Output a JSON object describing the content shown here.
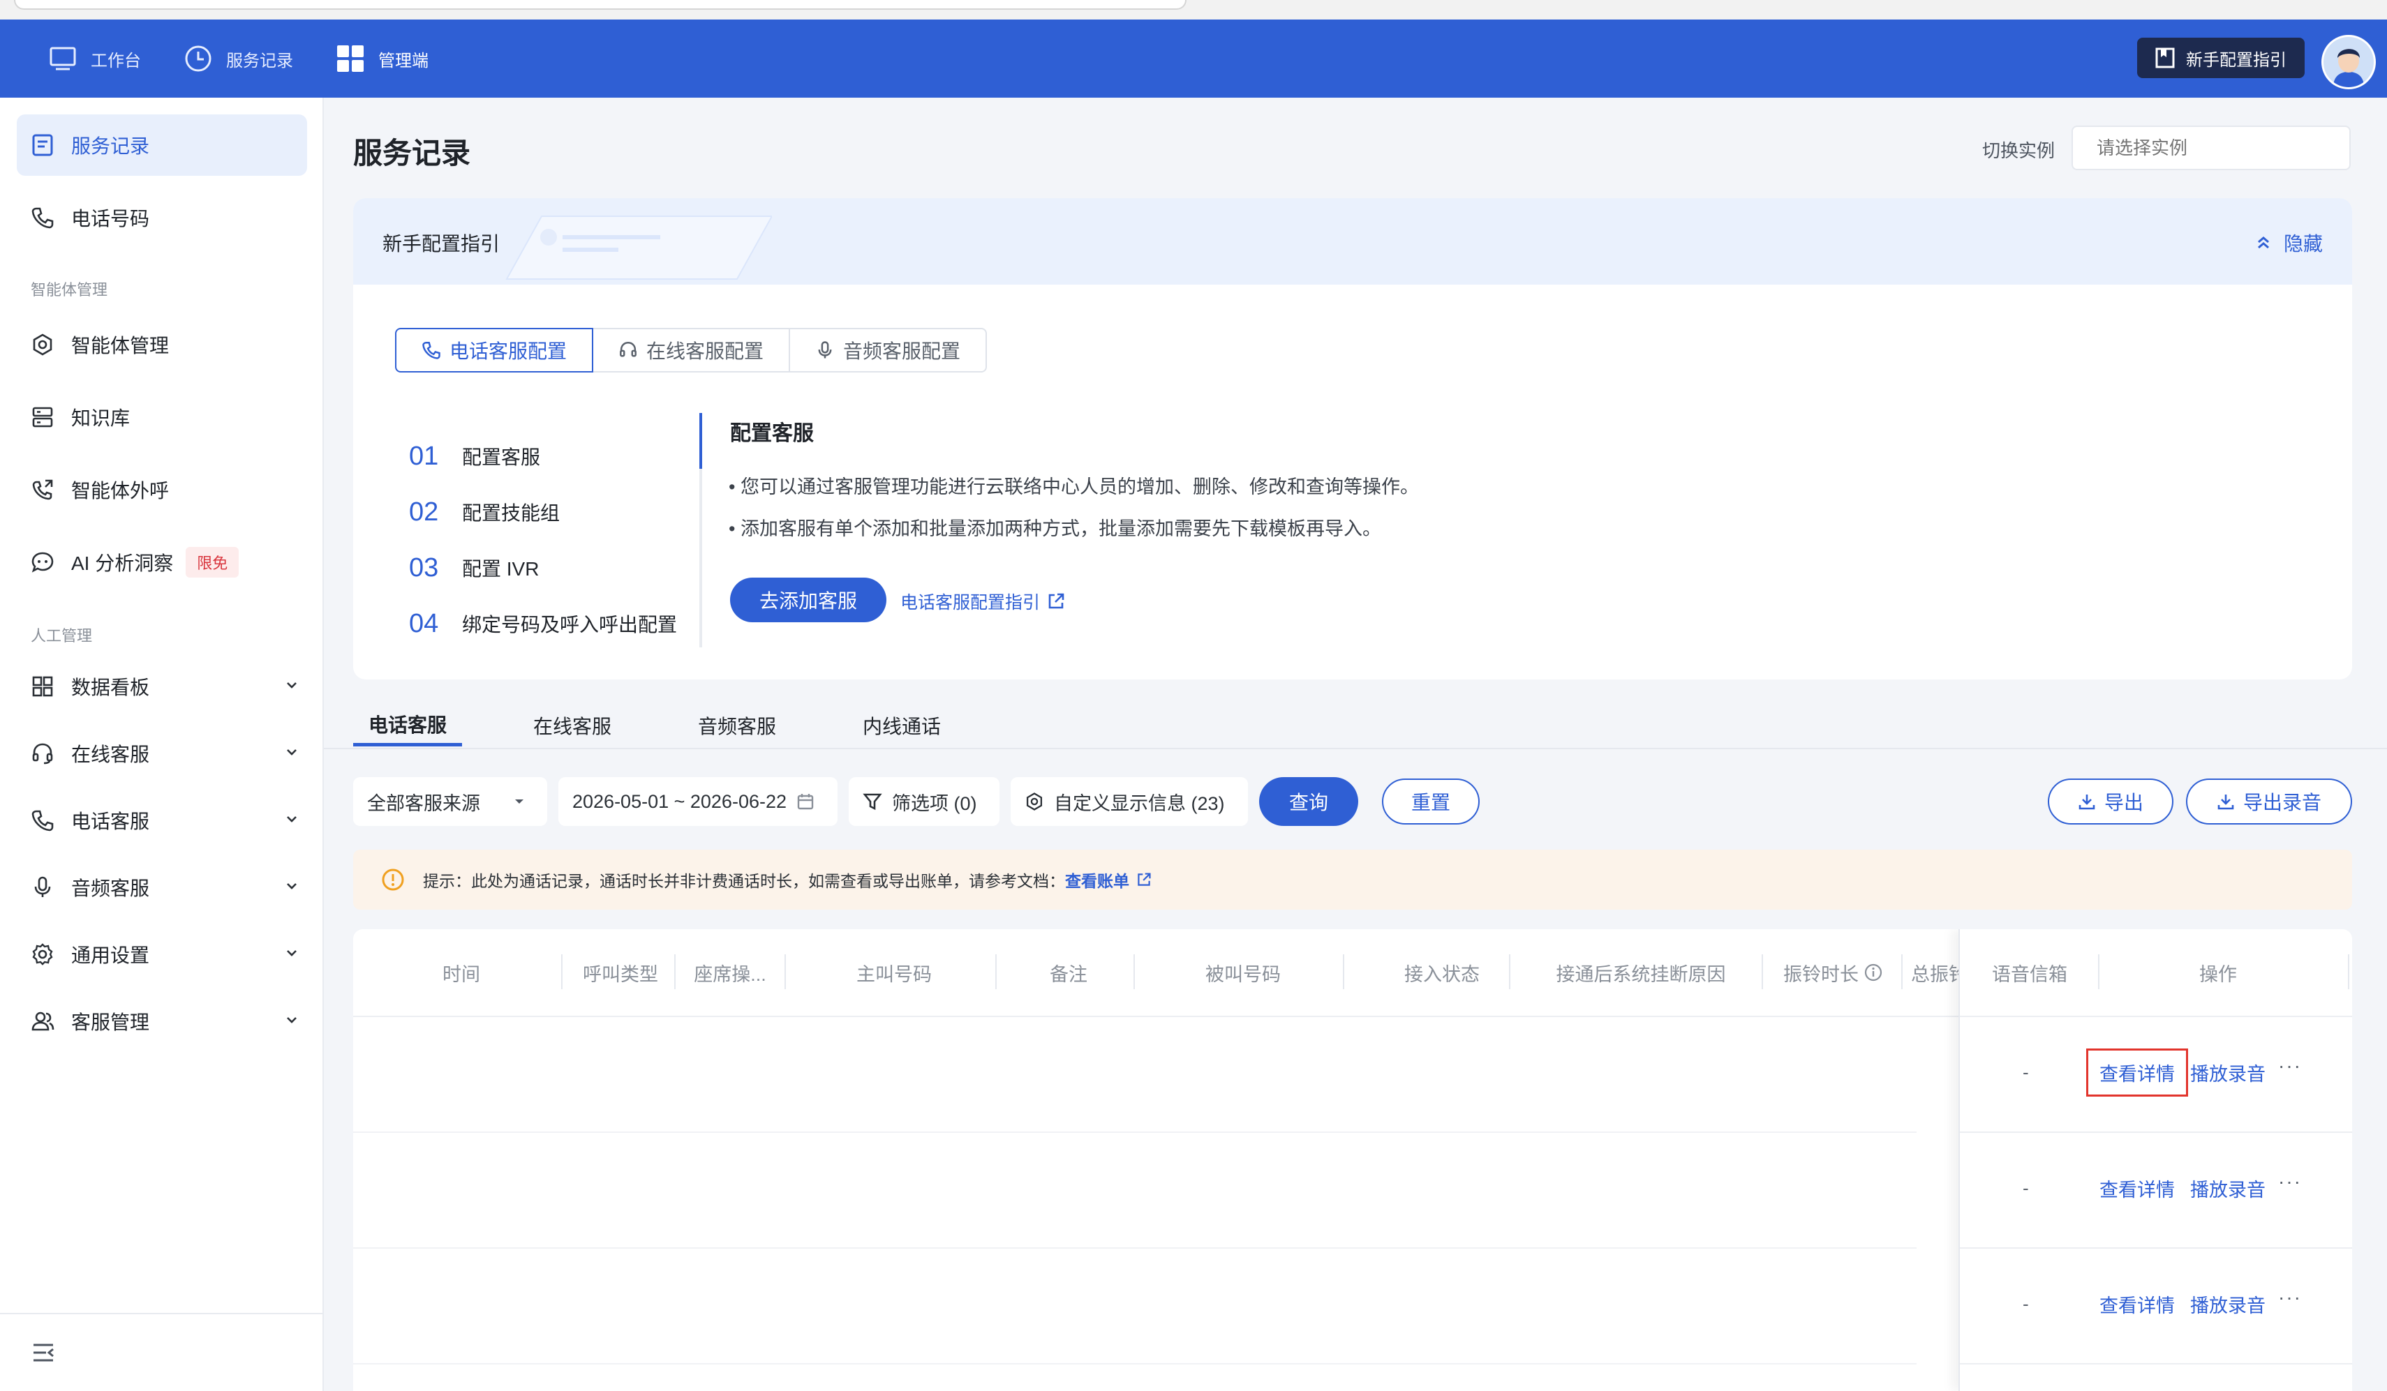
{
  "topnav": {
    "items": [
      {
        "label": "工作台",
        "icon": "monitor-icon"
      },
      {
        "label": "服务记录",
        "icon": "clock-icon"
      },
      {
        "label": "管理端",
        "icon": "grid-icon"
      }
    ],
    "guide_button": "新手配置指引",
    "accent": "#2f5fd4"
  },
  "sidebar": {
    "items": [
      {
        "label": "服务记录",
        "icon": "document-icon",
        "active": true
      },
      {
        "label": "电话号码",
        "icon": "phone-icon"
      }
    ],
    "section_agent": "智能体管理",
    "agent_items": [
      {
        "label": "智能体管理",
        "icon": "hexagon-icon"
      },
      {
        "label": "知识库",
        "icon": "database-icon"
      },
      {
        "label": "智能体外呼",
        "icon": "phone-out-icon"
      },
      {
        "label": "AI 分析洞察",
        "icon": "ai-chat-icon",
        "badge": "限免"
      }
    ],
    "section_manual": "人工管理",
    "manual_items": [
      {
        "label": "数据看板",
        "icon": "dashboard-icon"
      },
      {
        "label": "在线客服",
        "icon": "headset-icon"
      },
      {
        "label": "电话客服",
        "icon": "phone-icon"
      },
      {
        "label": "音频客服",
        "icon": "mic-icon"
      },
      {
        "label": "通用设置",
        "icon": "gear-icon"
      },
      {
        "label": "客服管理",
        "icon": "users-icon"
      }
    ]
  },
  "main": {
    "title": "服务记录",
    "switch_label": "切换实例",
    "switch_placeholder": "请选择实例"
  },
  "guide": {
    "title": "新手配置指引",
    "hide_label": "隐藏",
    "segments": [
      {
        "label": "电话客服配置",
        "icon": "phone-icon",
        "active": true
      },
      {
        "label": "在线客服配置",
        "icon": "headset-icon"
      },
      {
        "label": "音频客服配置",
        "icon": "mic-icon"
      }
    ],
    "steps": [
      {
        "num": "01",
        "label": "配置客服"
      },
      {
        "num": "02",
        "label": "配置技能组"
      },
      {
        "num": "03",
        "label": "配置 IVR"
      },
      {
        "num": "04",
        "label": "绑定号码及呼入呼出配置"
      }
    ],
    "detail_title": "配置客服",
    "detail_lines": [
      "• 您可以通过客服管理功能进行云联络中心人员的增加、删除、修改和查询等操作。",
      "• 添加客服有单个添加和批量添加两种方式，批量添加需要先下载模板再导入。"
    ],
    "add_button": "去添加客服",
    "link": "电话客服配置指引"
  },
  "tabs": [
    "电话客服",
    "在线客服",
    "音频客服",
    "内线通话"
  ],
  "filters": {
    "source": "全部客服来源",
    "date_range": "2026-05-01 ~ 2026-06-22",
    "filter_btn": "筛选项 (0)",
    "custom_btn": "自定义显示信息 (23)",
    "query": "查询",
    "reset": "重置",
    "export": "导出",
    "export_audio": "导出录音"
  },
  "notice": {
    "text": "提示：此处为通话记录，通话时长并非计费通话时长，如需查看或导出账单，请参考文档：",
    "link": "查看账单"
  },
  "table": {
    "columns": [
      "时间",
      "呼叫类型",
      "座席操...",
      "主叫号码",
      "备注",
      "被叫号码",
      "接入状态",
      "接通后系统挂断原因",
      "振铃时长",
      "总振铃"
    ],
    "fixed_columns": [
      "语音信箱",
      "操作"
    ],
    "rows": [
      {
        "voicemail": "-",
        "view": "查看详情",
        "play": "播放录音",
        "more": "···"
      },
      {
        "voicemail": "-",
        "view": "查看详情",
        "play": "播放录音",
        "more": "···"
      },
      {
        "voicemail": "-",
        "view": "查看详情",
        "play": "播放录音",
        "more": "···"
      }
    ]
  }
}
